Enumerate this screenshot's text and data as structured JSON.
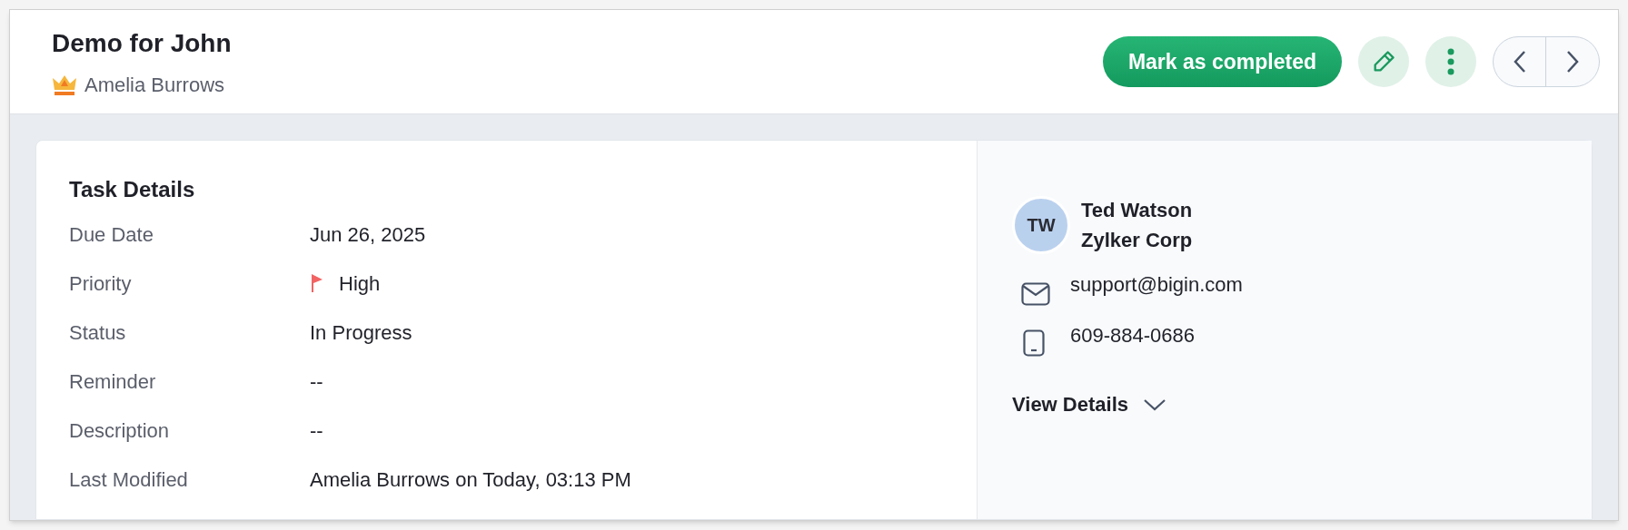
{
  "header": {
    "title": "Demo for John",
    "owner": "Amelia Burrows",
    "actions": {
      "complete": "Mark as completed"
    }
  },
  "task_details": {
    "title": "Task Details",
    "fields": [
      {
        "label": "Due Date",
        "value": "Jun 26, 2025",
        "kind": "text"
      },
      {
        "label": "Priority",
        "value": "High",
        "kind": "priority"
      },
      {
        "label": "Status",
        "value": "In Progress",
        "kind": "text"
      },
      {
        "label": "Reminder",
        "value": "--",
        "kind": "text"
      },
      {
        "label": "Description",
        "value": "--",
        "kind": "text"
      },
      {
        "label": "Last Modified",
        "value": "Amelia Burrows on Today, 03:13 PM",
        "kind": "text"
      }
    ]
  },
  "contact": {
    "initials": "TW",
    "name": "Ted Watson",
    "company": "Zylker Corp",
    "email": "support@bigin.com",
    "phone": "609-884-0686",
    "view_details": "View Details"
  }
}
